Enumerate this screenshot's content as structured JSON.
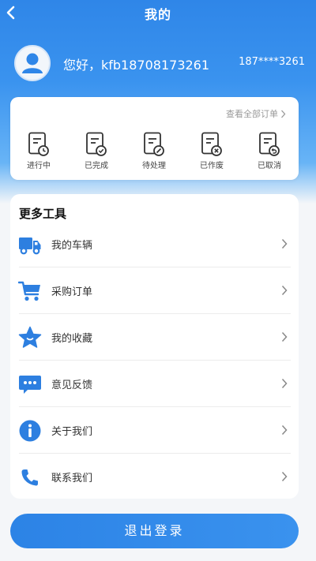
{
  "header": {
    "title": "我的",
    "back_icon": "chevron-left-icon"
  },
  "profile": {
    "avatar_icon": "user-avatar-icon",
    "greeting": "您好，kfb18708173261",
    "phone": "187****3261"
  },
  "orders": {
    "view_all_label": "查看全部订单",
    "statuses": [
      {
        "label": "进行中",
        "icon": "order-in-progress-icon"
      },
      {
        "label": "已完成",
        "icon": "order-completed-icon"
      },
      {
        "label": "待处理",
        "icon": "order-pending-icon"
      },
      {
        "label": "已作废",
        "icon": "order-voided-icon"
      },
      {
        "label": "已取消",
        "icon": "order-cancelled-icon"
      }
    ]
  },
  "tools": {
    "title": "更多工具",
    "items": [
      {
        "label": "我的车辆",
        "icon": "truck-icon"
      },
      {
        "label": "采购订单",
        "icon": "shopping-cart-icon"
      },
      {
        "label": "我的收藏",
        "icon": "star-icon"
      },
      {
        "label": "意见反馈",
        "icon": "message-icon"
      },
      {
        "label": "关于我们",
        "icon": "info-icon"
      },
      {
        "label": "联系我们",
        "icon": "phone-icon"
      }
    ]
  },
  "logout": {
    "label": "退出登录"
  },
  "colors": {
    "primary": "#2f86e8",
    "icon_blue": "#2d7fe0",
    "background": "#f4f6f9"
  }
}
